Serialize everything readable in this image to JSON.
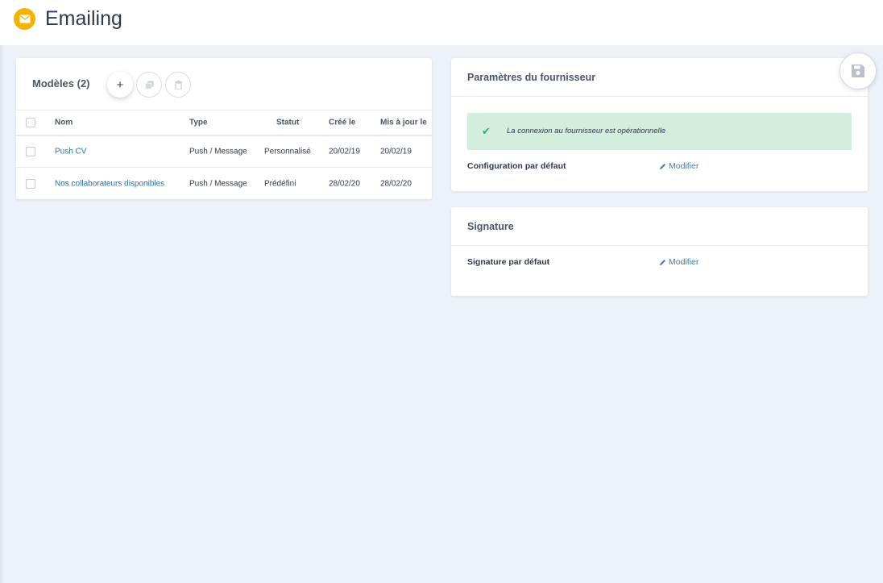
{
  "app": {
    "title": "Emailing",
    "icon": "envelope-icon",
    "accent_color": "#f5b301"
  },
  "models": {
    "title": "Modèles (2)",
    "actions": [
      {
        "name": "add",
        "icon": "plus-icon",
        "label": "+"
      },
      {
        "name": "duplicate",
        "icon": "copy-icon"
      },
      {
        "name": "delete",
        "icon": "trash-icon"
      }
    ],
    "columns": [
      "Nom",
      "Type",
      "Statut",
      "Créé le",
      "Mis à jour le"
    ],
    "rows": [
      {
        "name": "Push CV",
        "type": "Push / Message",
        "status": "Personnalisé",
        "created": "20/02/19",
        "updated": "20/02/19"
      },
      {
        "name": "Nos collaborateurs disponibles",
        "type": "Push / Message",
        "status": "Prédéfini",
        "created": "28/02/20",
        "updated": "28/02/20"
      }
    ]
  },
  "provider": {
    "title": "Paramètres du fournisseur",
    "alert_text": "La connexion au fournisseur est opérationnelle",
    "alert_color": "#d3eedd",
    "config_label": "Configuration par défaut",
    "config_link": "Modifier"
  },
  "signature": {
    "title": "Signature",
    "label": "Signature par défaut",
    "link": "Modifier"
  },
  "save_button": {
    "icon": "floppy-disk-icon"
  }
}
